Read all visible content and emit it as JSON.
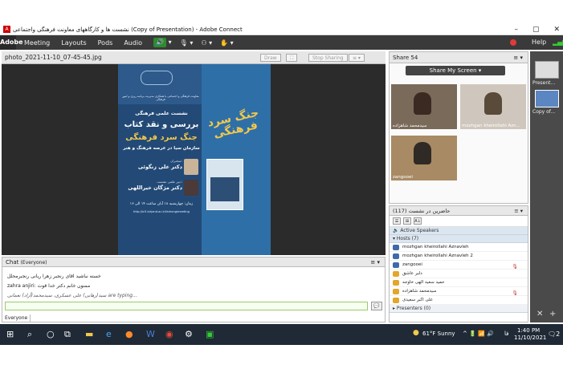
{
  "window": {
    "title": "نشست ها و کارگاههای معاونت فرهنگی واجتماعی (Copy of Presentation) - Adobe Connect",
    "minimize": "–",
    "maximize": "▢",
    "close": "✕"
  },
  "menu": {
    "logo": "Adobe",
    "items": [
      "Meeting",
      "Layouts",
      "Pods",
      "Audio"
    ],
    "help": "Help"
  },
  "share_pod": {
    "title": "photo_2021-11-10_07-45-45.jpg",
    "draw_btn": "Draw",
    "stop_sharing": "Stop Sharing"
  },
  "poster": {
    "org_lines": "معاونت فرهنگی و اجتماعی با همکاری مدیریت برنامه ریزی و امور فرهنگی",
    "session_type": "نشست علمی فرهنگی",
    "heading1": "بررسی و نقد کتاب",
    "heading2": "جنگ سرد فرهنگی",
    "heading3": "سازمان سیا در عرصه فرهنگ و هنر",
    "side_title": "جنگ سرد فرهنگی",
    "speaker_label": "سخنران:",
    "speaker_name": "دکتر علی زنگوئی",
    "moderator_label": "دبیر علمی نشست:",
    "moderator_name": "دکتر مژگان خیراللهی",
    "time": "زمان: چهارشنبه ۱۸ آبان ساعت ۱۴ الی ۱۶",
    "url": "http://lc5.birjand.ac.ir/farhangimeeting"
  },
  "video_pod": {
    "title": "Share 54",
    "share_my_screen": "Share My Screen",
    "participants": [
      {
        "name": "سیدمحمد شاهزاده"
      },
      {
        "name": "mozhgan kheirollahi Azn..."
      },
      {
        "name": "zangooei"
      }
    ]
  },
  "attendees_pod": {
    "title": "حاضرین در نشست",
    "count": "(117)",
    "active_speakers": "Active Speakers",
    "hosts_group": "Hosts (7)",
    "presenters_group": "Presenters (0)",
    "hosts": [
      "mozhgan kheirollahi Aznavleh",
      "mozhgan kheirollahi Aznavleh 2",
      "zangooei",
      "دلبر عاشق",
      "حمید سعید  الهی  خاوجه",
      "سیدمحمد شاهزاده",
      "علی اکبر سعیدی"
    ]
  },
  "layouts": [
    {
      "label": "Present..."
    },
    {
      "label": "Copy of..."
    }
  ],
  "chat_pod": {
    "title": "Chat",
    "scope": "(Everyone)",
    "messages": [
      "خسته نباشید اقای رنجبر زهرا ریانی رنجبرمحلل",
      "zahra anjiri:  ممنون خانم دکتر خدا قوت",
      "سید(رهایی) علی عسکری، سیدمحمد(آزاد) نعمانی are typing..."
    ],
    "send": "💬",
    "tab": "Everyone"
  },
  "taskbar": {
    "weather": "61°F  Sunny",
    "lang": "فا",
    "time": "1:40 PM",
    "date": "11/10/2021",
    "notif": "2"
  },
  "colors": {
    "menubar": "#3a3a3a",
    "poster_bg": "#234a76",
    "taskbar": "#1f2a36",
    "accent_yellow": "#f2c94c"
  }
}
